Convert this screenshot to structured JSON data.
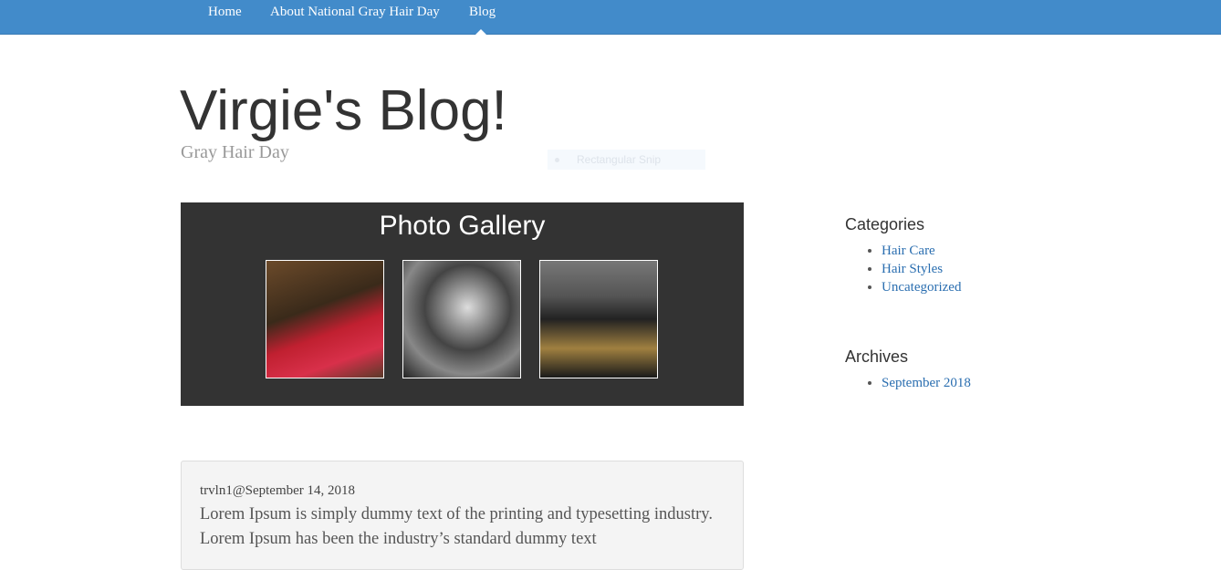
{
  "nav": {
    "items": [
      "Home",
      "About National Gray Hair Day",
      "Blog"
    ],
    "active": "Blog"
  },
  "site": {
    "title": "Virgie's Blog!",
    "tagline": "Gray Hair Day"
  },
  "overlay": {
    "snip_label": "Rectangular Snip"
  },
  "gallery": {
    "title": "Photo Gallery"
  },
  "post": {
    "meta": "trvln1@September 14, 2018",
    "body": "Lorem Ipsum is simply dummy text of the printing and typesetting industry. Lorem Ipsum has been the industry’s standard dummy text"
  },
  "sidebar": {
    "categories_title": "Categories",
    "categories": [
      "Hair Care",
      "Hair Styles",
      "Uncategorized"
    ],
    "archives_title": "Archives",
    "archives": [
      "September 2018"
    ]
  },
  "colors": {
    "nav": "#428bca",
    "link": "#2a6eb0"
  }
}
